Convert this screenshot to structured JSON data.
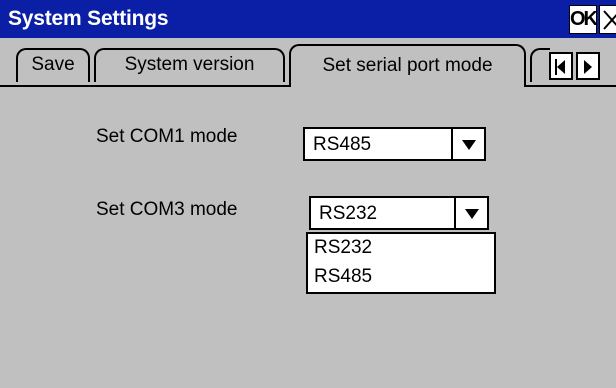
{
  "window": {
    "title": "System Settings",
    "ok_label": "OK"
  },
  "tabs": [
    {
      "label": "Save",
      "selected": false
    },
    {
      "label": "System version",
      "selected": false
    },
    {
      "label": "Set serial port mode",
      "selected": true
    }
  ],
  "form": {
    "com1": {
      "label": "Set COM1 mode",
      "value": "RS485"
    },
    "com3": {
      "label": "Set COM3 mode",
      "value": "RS232"
    }
  },
  "dropdown": {
    "options": [
      "RS232",
      "RS485"
    ]
  },
  "colors": {
    "titlebar": "#0a1ea6",
    "background": "#c0c0c0"
  },
  "icons": {
    "close": "close-icon",
    "combo_arrow": "triangle-down-icon",
    "scroll_left": "triangle-left-icon",
    "scroll_right": "triangle-right-icon"
  }
}
